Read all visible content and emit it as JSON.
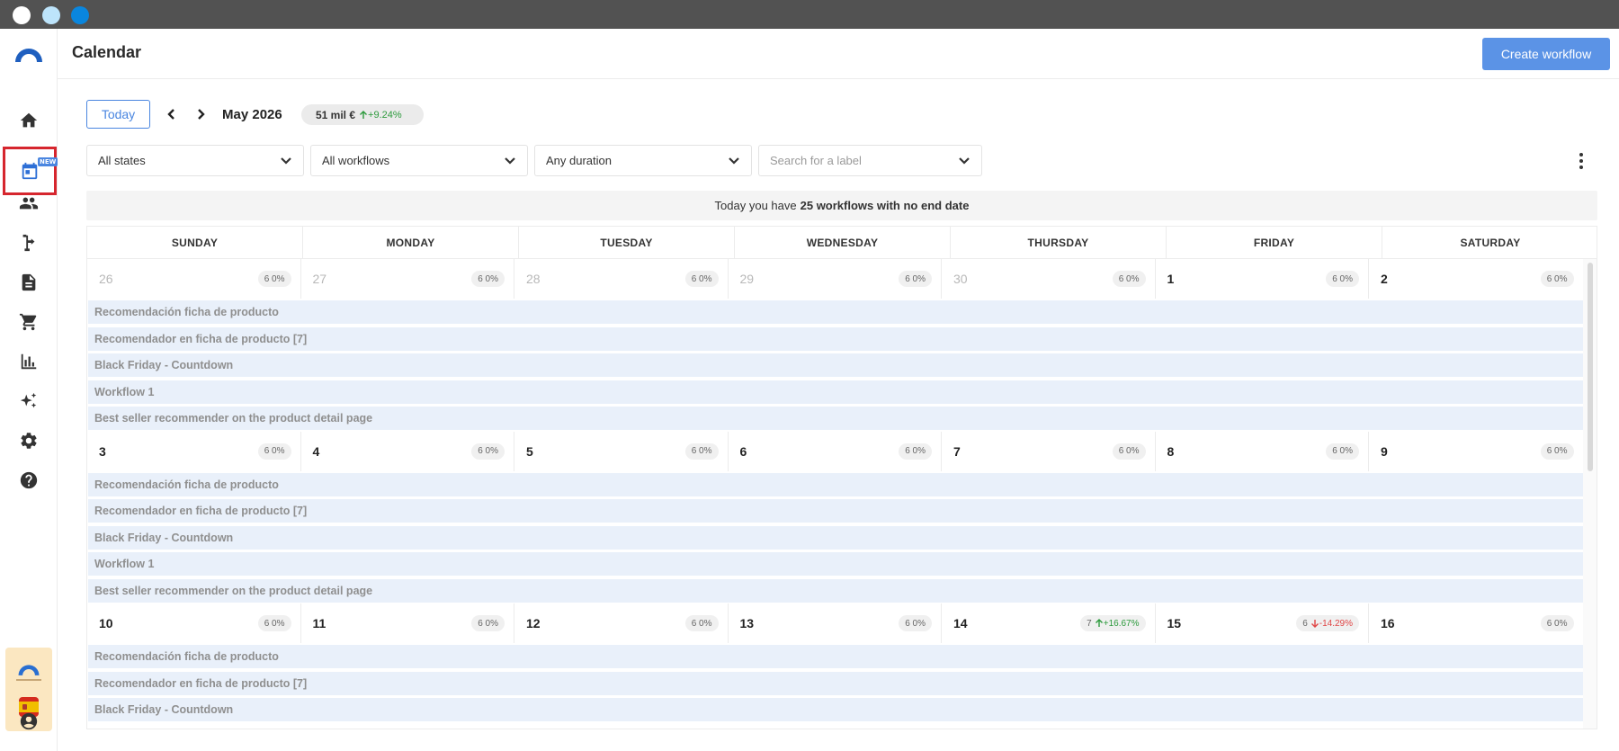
{
  "window": {
    "buttons": [
      "close",
      "minimize",
      "maximize"
    ]
  },
  "sidebar": {
    "logo_icon": "arc-logo-icon",
    "items": [
      {
        "name": "home-icon"
      },
      {
        "name": "calendar-icon",
        "badge": "NEW",
        "active": true
      },
      {
        "name": "people-icon"
      },
      {
        "name": "workflow-branch-icon"
      },
      {
        "name": "document-icon"
      },
      {
        "name": "cart-icon"
      },
      {
        "name": "bar-chart-icon"
      },
      {
        "name": "sparkle-icon"
      },
      {
        "name": "gear-icon"
      },
      {
        "name": "help-icon"
      }
    ],
    "footer": {
      "brand_icon": "brand-icon",
      "flag": "spain-flag-icon",
      "account_icon": "account-icon"
    }
  },
  "header": {
    "title": "Calendar",
    "create_button": "Create workflow"
  },
  "toolbar": {
    "today_label": "Today",
    "month_label": "May 2026",
    "kpi": {
      "value": "51 mil €",
      "delta": "+9.24%"
    }
  },
  "filters": {
    "states": "All states",
    "workflows": "All workflows",
    "duration": "Any duration",
    "label_placeholder": "Search for a label"
  },
  "banner": {
    "prefix": "Today you have",
    "highlight": "25 workflows with no end date"
  },
  "colors": {
    "accent": "#4a86e0",
    "primary_button": "#5b93e6",
    "positive": "#2c9a3c",
    "negative": "#e04646",
    "workflow_bar": "#e9f0fa"
  },
  "calendar": {
    "days_of_week": [
      "SUNDAY",
      "MONDAY",
      "TUESDAY",
      "WEDNESDAY",
      "THURSDAY",
      "FRIDAY",
      "SATURDAY"
    ],
    "weeks": [
      {
        "days": [
          {
            "num": "26",
            "muted": true,
            "badge": "6 0%"
          },
          {
            "num": "27",
            "muted": true,
            "badge": "6 0%"
          },
          {
            "num": "28",
            "muted": true,
            "badge": "6 0%"
          },
          {
            "num": "29",
            "muted": true,
            "badge": "6 0%"
          },
          {
            "num": "30",
            "muted": true,
            "badge": "6 0%"
          },
          {
            "num": "1",
            "badge": "6 0%"
          },
          {
            "num": "2",
            "badge": "6 0%"
          }
        ],
        "workflows": [
          "Recomendación ficha de producto",
          "Recomendador en ficha de producto [7]",
          "Black Friday - Countdown",
          "Workflow 1",
          "Best seller recommender on the product detail page"
        ]
      },
      {
        "days": [
          {
            "num": "3",
            "badge": "6 0%"
          },
          {
            "num": "4",
            "badge": "6 0%"
          },
          {
            "num": "5",
            "badge": "6 0%"
          },
          {
            "num": "6",
            "badge": "6 0%"
          },
          {
            "num": "7",
            "badge": "6 0%"
          },
          {
            "num": "8",
            "badge": "6 0%"
          },
          {
            "num": "9",
            "badge": "6 0%"
          }
        ],
        "workflows": [
          "Recomendación ficha de producto",
          "Recomendador en ficha de producto [7]",
          "Black Friday - Countdown",
          "Workflow 1",
          "Best seller recommender on the product detail page"
        ]
      },
      {
        "days": [
          {
            "num": "10",
            "badge": "6 0%"
          },
          {
            "num": "11",
            "badge": "6 0%"
          },
          {
            "num": "12",
            "badge": "6 0%"
          },
          {
            "num": "13",
            "badge": "6 0%"
          },
          {
            "num": "14",
            "count": "7",
            "delta": "+16.67%",
            "trend": "up"
          },
          {
            "num": "15",
            "count": "6",
            "delta": "-14.29%",
            "trend": "down"
          },
          {
            "num": "16",
            "badge": "6 0%"
          }
        ],
        "workflows": [
          "Recomendación ficha de producto",
          "Recomendador en ficha de producto [7]",
          "Black Friday - Countdown"
        ]
      }
    ]
  }
}
